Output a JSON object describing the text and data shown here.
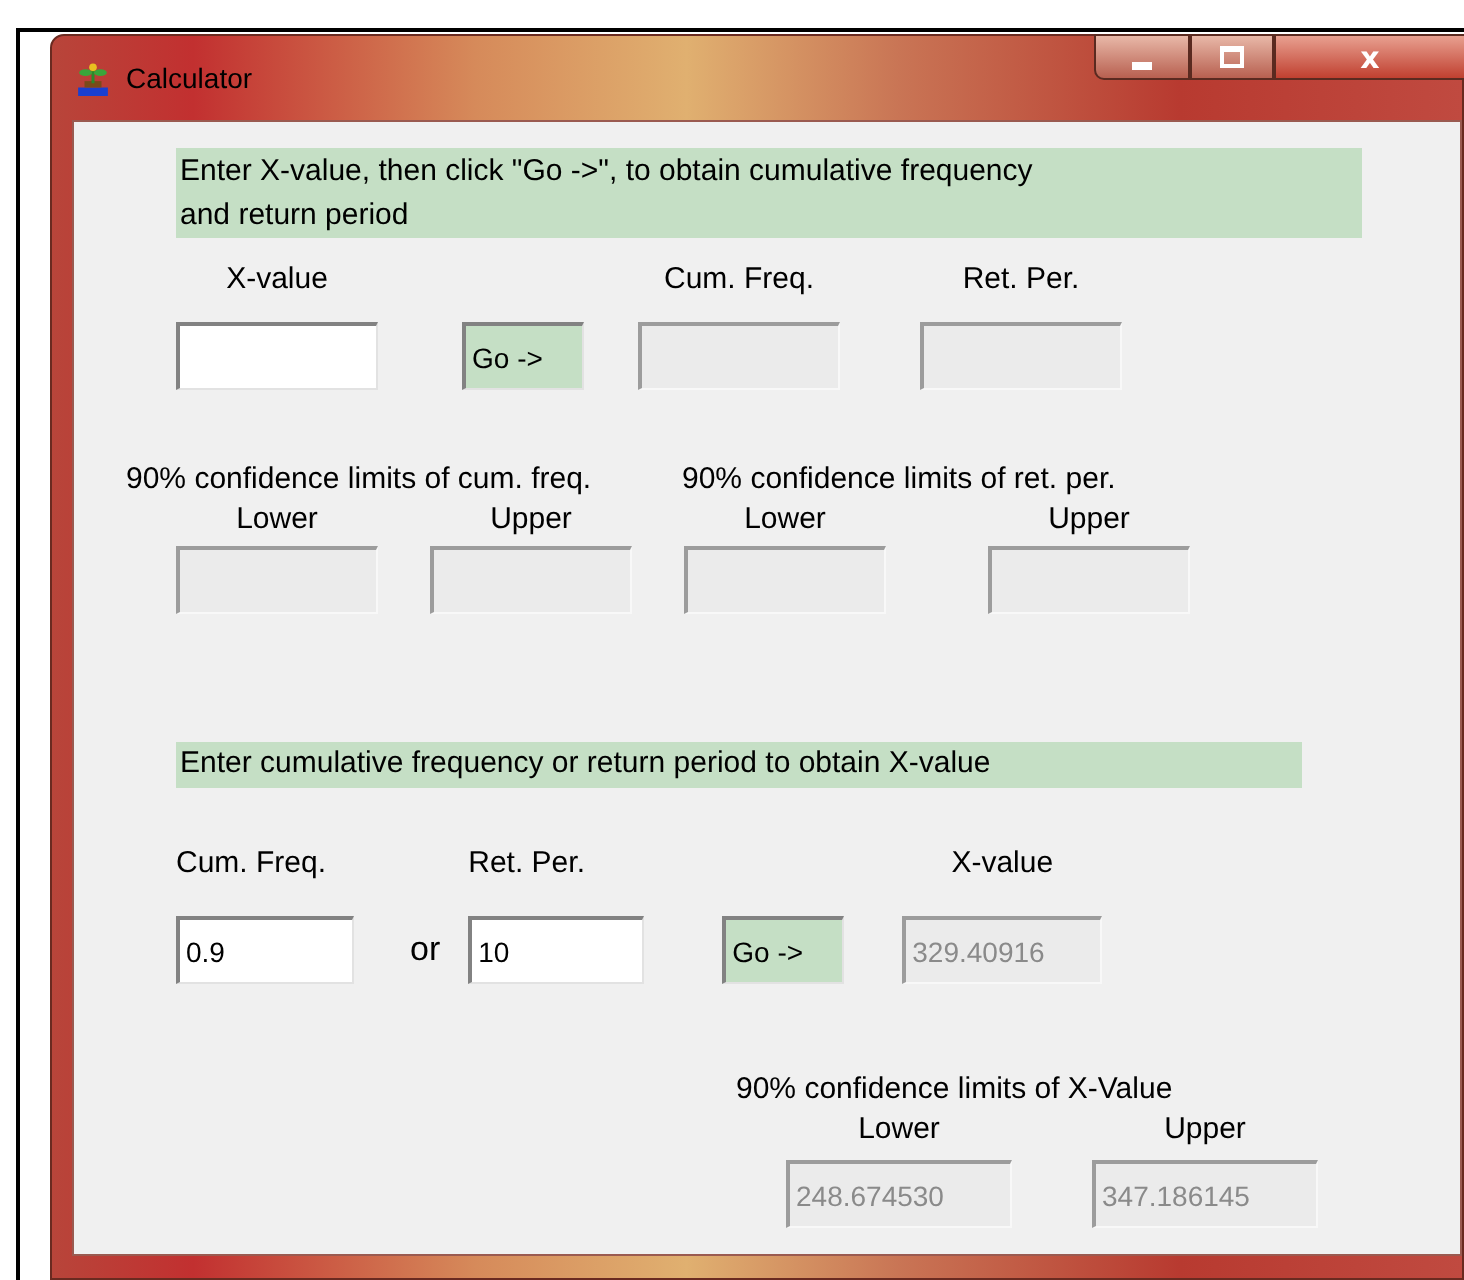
{
  "window": {
    "title": "Calculator",
    "controls": [
      {
        "kind": "minimize"
      },
      {
        "kind": "maximize"
      },
      {
        "kind": "close",
        "text": "x"
      }
    ]
  },
  "forward": {
    "instruction": "Enter X-value, then click \"Go ->\", to obtain cumulative frequency and return period",
    "items": [
      {
        "kind": "field",
        "label": "X-value",
        "disabled": false
      },
      {
        "kind": "button",
        "text": "Go ->"
      },
      {
        "kind": "field",
        "label": "Cum. Freq.",
        "disabled": true
      },
      {
        "kind": "field",
        "label": "Ret. Per.",
        "disabled": true
      }
    ],
    "limits": [
      {
        "heading": "90% confidence limits of cum. freq.",
        "fields": [
          {
            "label": "Lower",
            "disabled": true
          },
          {
            "label": "Upper",
            "disabled": true
          }
        ]
      },
      {
        "heading": "90% confidence limits of ret. per.",
        "fields": [
          {
            "label": "Lower",
            "disabled": true
          },
          {
            "label": "Upper",
            "disabled": true
          }
        ]
      }
    ]
  },
  "inverse": {
    "instruction": "Enter cumulative frequency or return period to obtain X-value",
    "items": [
      {
        "kind": "field",
        "label": "Cum. Freq.",
        "value": "0.9",
        "disabled": false
      },
      {
        "kind": "text",
        "text": "or"
      },
      {
        "kind": "field",
        "label": "Ret. Per.",
        "value": "10",
        "disabled": false
      },
      {
        "kind": "button",
        "text": "Go ->"
      },
      {
        "kind": "field",
        "label": "X-value",
        "value": "329.40916",
        "disabled": true
      }
    ],
    "limits": [
      {
        "heading": "90% confidence limits of X-Value",
        "fields": [
          {
            "label": "Lower",
            "value": "248.674530",
            "disabled": true
          },
          {
            "label": "Upper",
            "value": "347.186145",
            "disabled": true
          }
        ]
      }
    ]
  }
}
